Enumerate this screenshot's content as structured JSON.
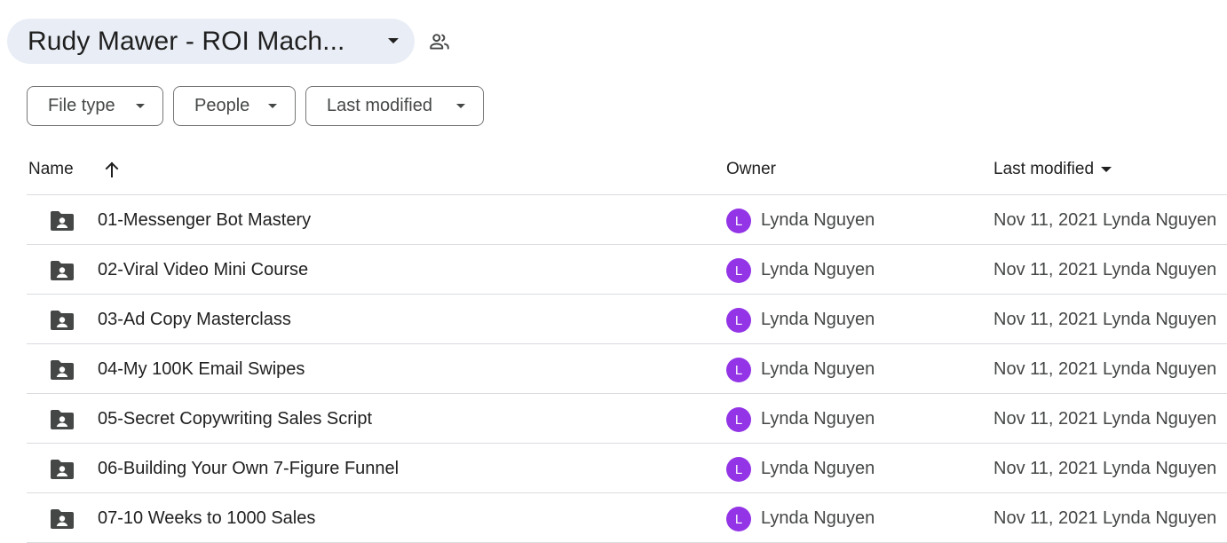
{
  "header": {
    "folder_title": "Rudy Mawer - ROI Mach...",
    "shared_icon": "people-icon"
  },
  "filters": {
    "file_type": "File type",
    "people": "People",
    "last_modified": "Last modified"
  },
  "columns": {
    "name": "Name",
    "owner": "Owner",
    "last_modified": "Last modified"
  },
  "rows": [
    {
      "name": "01-Messenger Bot Mastery",
      "avatar": "L",
      "owner": "Lynda Nguyen",
      "modified": "Nov 11, 2021 Lynda Nguyen"
    },
    {
      "name": "02-Viral Video Mini Course",
      "avatar": "L",
      "owner": "Lynda Nguyen",
      "modified": "Nov 11, 2021 Lynda Nguyen"
    },
    {
      "name": "03-Ad Copy Masterclass",
      "avatar": "L",
      "owner": "Lynda Nguyen",
      "modified": "Nov 11, 2021 Lynda Nguyen"
    },
    {
      "name": "04-My 100K Email Swipes",
      "avatar": "L",
      "owner": "Lynda Nguyen",
      "modified": "Nov 11, 2021 Lynda Nguyen"
    },
    {
      "name": "05-Secret Copywriting Sales Script",
      "avatar": "L",
      "owner": "Lynda Nguyen",
      "modified": "Nov 11, 2021 Lynda Nguyen"
    },
    {
      "name": "06-Building Your Own 7-Figure Funnel",
      "avatar": "L",
      "owner": "Lynda Nguyen",
      "modified": "Nov 11, 2021 Lynda Nguyen"
    },
    {
      "name": "07-10 Weeks to 1000 Sales",
      "avatar": "L",
      "owner": "Lynda Nguyen",
      "modified": "Nov 11, 2021 Lynda Nguyen"
    }
  ],
  "colors": {
    "avatar_bg": "#9334e6",
    "title_chip_bg": "#e9eef6",
    "folder_icon": "#444746"
  }
}
